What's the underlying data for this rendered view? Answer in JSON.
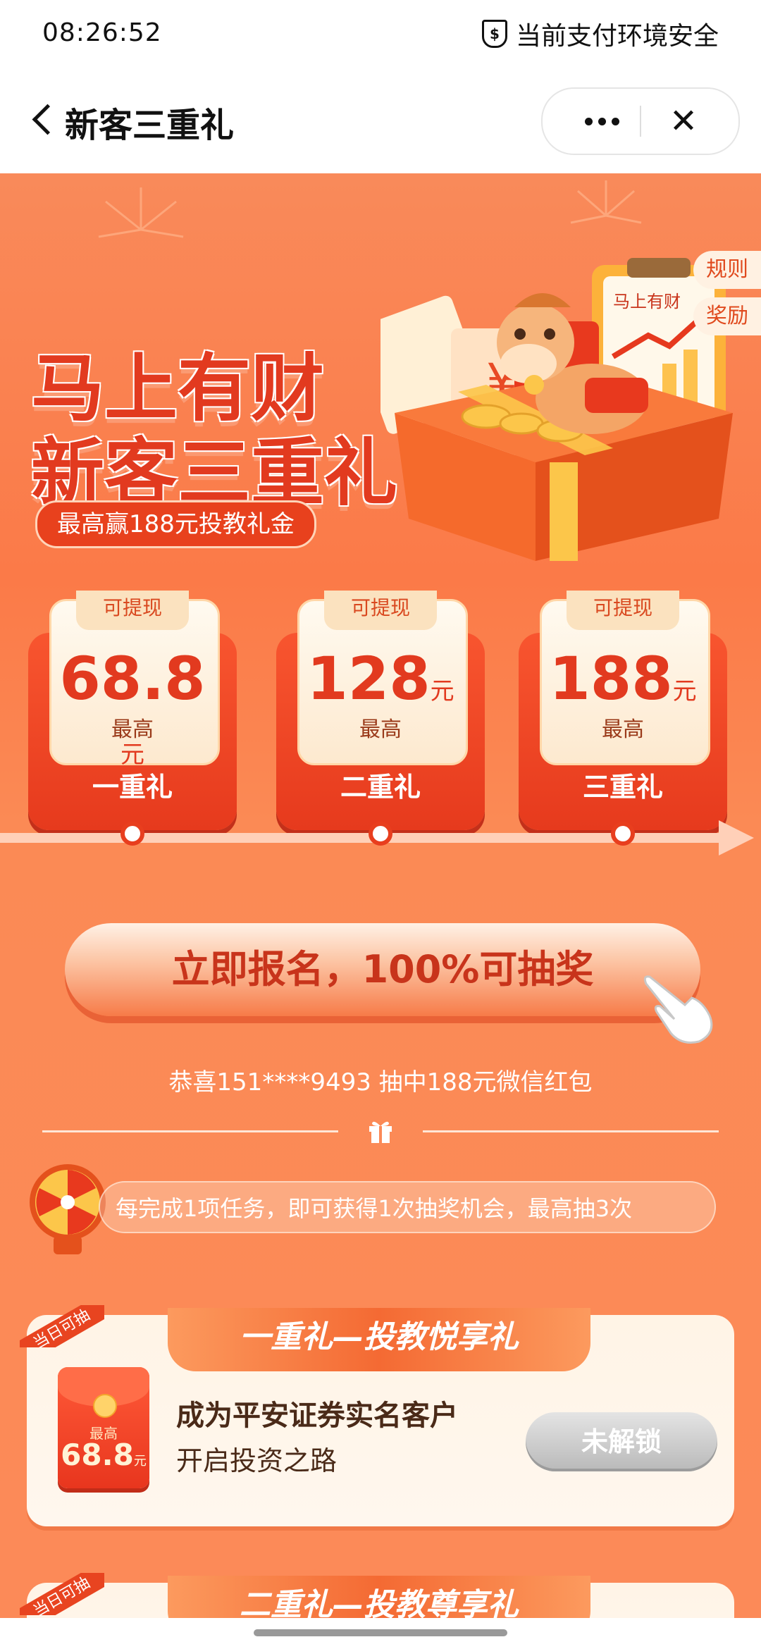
{
  "status": {
    "time": "08:26:52",
    "security_text": "当前支付环境安全"
  },
  "nav": {
    "title": "新客三重礼"
  },
  "hero": {
    "title_line1": "马上有财",
    "title_line2": "新客三重礼",
    "subtitle": "最高赢188元投教礼金",
    "board_text": "马上有财"
  },
  "side_tabs": {
    "rules": "规则",
    "rewards": "奖励"
  },
  "rewards": [
    {
      "tag": "可提现",
      "amount": "68.8",
      "unit": "元",
      "max": "最高",
      "name": "一重礼"
    },
    {
      "tag": "可提现",
      "amount": "128",
      "unit": "元",
      "max": "最高",
      "name": "二重礼"
    },
    {
      "tag": "可提现",
      "amount": "188",
      "unit": "元",
      "max": "最高",
      "name": "三重礼"
    }
  ],
  "cta": {
    "label": "立即报名，100%可抽奖"
  },
  "winner": {
    "text": "恭喜151****9493 抽中188元微信红包"
  },
  "tasks_info": {
    "text": "每完成1项任务，即可获得1次抽奖机会，最高抽3次"
  },
  "task1": {
    "ribbon": "当日可抽",
    "header": "一重礼—投教悦享礼",
    "redpack_label": "最高",
    "redpack_amount": "68.8",
    "redpack_unit": "元",
    "title": "成为平安证券实名客户",
    "subtitle": "开启投资之路",
    "button": "未解锁"
  },
  "task2": {
    "ribbon": "当日可抽",
    "header": "二重礼—投教尊享礼"
  },
  "colors": {
    "accent": "#fb7a48",
    "brand_red": "#e23a1f",
    "locked": "#bdbdbd"
  }
}
